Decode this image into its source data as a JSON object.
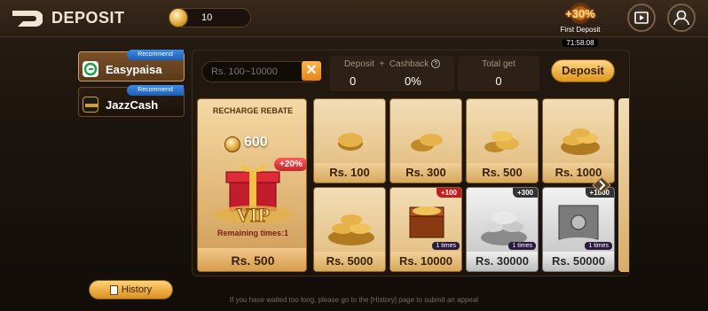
{
  "header": {
    "title": "DEPOSIT",
    "balance": "10",
    "first_deposit": {
      "percent": "+30%",
      "label": "First Deposit",
      "timer": "71:58:08"
    }
  },
  "payment_methods": [
    {
      "label": "Easypaisa",
      "badge": "Recommend",
      "active": true
    },
    {
      "label": "JazzCash",
      "badge": "Recommend",
      "active": false
    }
  ],
  "history_button": "History",
  "input": {
    "placeholder": "Rs. 100~10000",
    "value": ""
  },
  "summary": {
    "deposit_label": "Deposit",
    "plus": "+",
    "cashback_label": "Cashback",
    "deposit_value": "0",
    "cashback_value": "0%",
    "total_label": "Total get",
    "total_value": "0"
  },
  "deposit_button": "Deposit",
  "vip_card": {
    "title": "RECHARGE REBATE",
    "coins": "600",
    "bonus": "+20%",
    "vip_text": "VIP",
    "remaining": "Remaining times:1",
    "price": "Rs. 500"
  },
  "packages": [
    {
      "price": "Rs. 100",
      "style": "gold"
    },
    {
      "price": "Rs. 300",
      "style": "gold"
    },
    {
      "price": "Rs. 500",
      "style": "gold"
    },
    {
      "price": "Rs. 1000",
      "style": "gold"
    },
    {
      "price": "Rs. 5000",
      "style": "gold"
    },
    {
      "price": "Rs. 10000",
      "style": "gold",
      "bonus": "+100",
      "times": "1 times"
    },
    {
      "price": "Rs. 30000",
      "style": "silver",
      "bonus": "+300",
      "times": "1 times"
    },
    {
      "price": "Rs. 50000",
      "style": "silver",
      "bonus": "+1000",
      "times": "1 times"
    }
  ],
  "footer_note": "If you have waited too long, please go to the [History] page to submit an appeal",
  "icons": {
    "back": "back-arrow-icon",
    "coin": "coin-icon",
    "video": "video-play-icon",
    "profile": "profile-icon",
    "clear": "close-icon",
    "info": "question-icon",
    "history": "document-icon",
    "arrow": "chevron-right-icon"
  }
}
